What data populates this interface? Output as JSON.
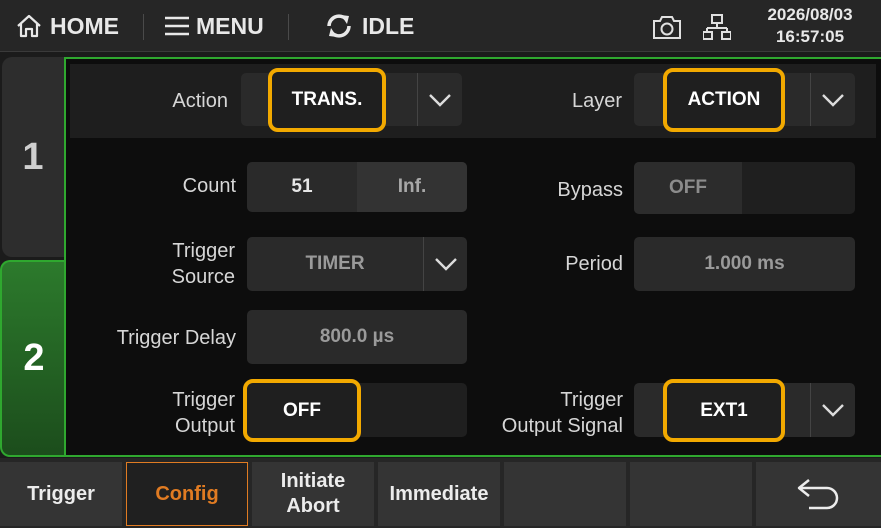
{
  "topbar": {
    "home_label": "HOME",
    "menu_label": "MENU",
    "status_label": "IDLE",
    "date": "2026/08/03",
    "time": "16:57:05",
    "icons": [
      "home-icon",
      "menu-icon",
      "refresh-icon",
      "camera-icon",
      "network-icon"
    ]
  },
  "channels": [
    {
      "label": "1",
      "active": false
    },
    {
      "label": "2",
      "active": true
    }
  ],
  "header": {
    "action_label": "Action",
    "action_value": "TRANS.",
    "layer_label": "Layer",
    "layer_value": "ACTION"
  },
  "config": {
    "count_label": "Count",
    "count_value": "51",
    "count_inf": "Inf.",
    "bypass_label": "Bypass",
    "bypass_value": "OFF",
    "trigger_source_label_1": "Trigger",
    "trigger_source_label_2": "Source",
    "trigger_source_value": "TIMER",
    "period_label": "Period",
    "period_value": "1.000 ms",
    "trigger_delay_label": "Trigger Delay",
    "trigger_delay_value": "800.0 µs",
    "trigger_output_label_1": "Trigger",
    "trigger_output_label_2": "Output",
    "trigger_output_value": "OFF",
    "trigger_output_signal_label_1": "Trigger",
    "trigger_output_signal_label_2": "Output Signal",
    "trigger_output_signal_value": "EXT1"
  },
  "softkeys": {
    "trigger": "Trigger",
    "config": "Config",
    "initiate_abort_1": "Initiate",
    "initiate_abort_2": "Abort",
    "immediate": "Immediate"
  },
  "colors": {
    "accent_green": "#2fa82f",
    "highlight": "#f2a900",
    "active_softkey": "#e07b22"
  }
}
